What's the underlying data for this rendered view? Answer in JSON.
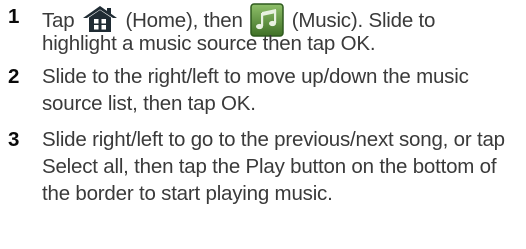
{
  "steps": [
    {
      "number": "1",
      "text_before_home": "Tap",
      "text_home": "(Home), then",
      "text_music": "(Music). Slide to",
      "text_rest": "highlight a music source then tap OK."
    },
    {
      "number": "2",
      "text": "Slide to the right/left to move up/down the music source list, then tap OK."
    },
    {
      "number": "3",
      "text": "Slide right/left to go to the previous/next song, or tap Select all, then tap the Play button on the bottom of the border to start playing music."
    }
  ],
  "icons": {
    "home": "home-icon",
    "music": "music-note-icon",
    "home_color": "#1f2b33",
    "music_bg": "#5a8a3c",
    "music_border": "#2f5a1e"
  }
}
